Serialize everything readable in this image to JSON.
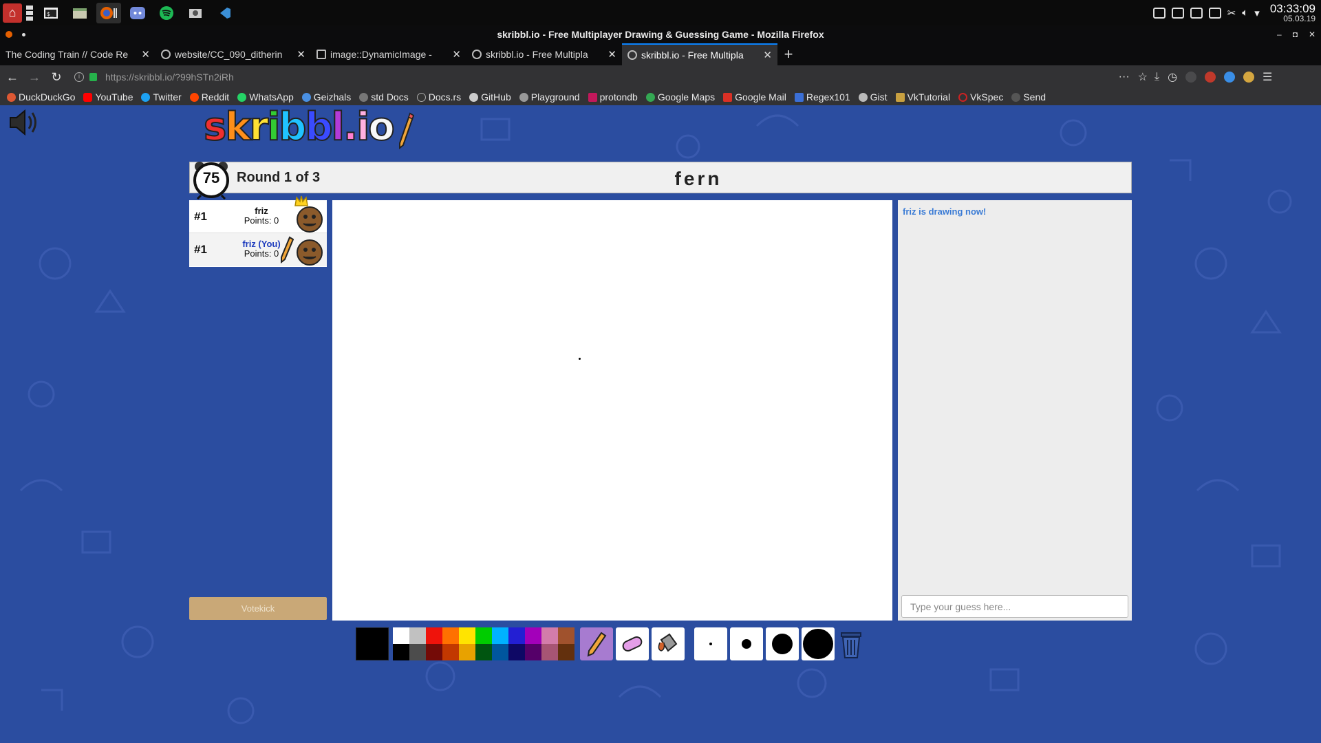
{
  "os": {
    "clock_time": "03:33:09",
    "clock_date": "05.03.19"
  },
  "window": {
    "title": "skribbl.io - Free Multiplayer Drawing & Guessing Game - Mozilla Firefox"
  },
  "tabs": [
    {
      "label": "The Coding Train // Code Re",
      "active": false
    },
    {
      "label": "website/CC_090_ditherin",
      "active": false
    },
    {
      "label": "image::DynamicImage -",
      "active": false
    },
    {
      "label": "skribbl.io - Free Multipla",
      "active": false
    },
    {
      "label": "skribbl.io - Free Multipla",
      "active": true
    }
  ],
  "nav": {
    "url": "https://skribbl.io/?99hSTn2iRh"
  },
  "bookmarks": [
    {
      "label": "DuckDuckGo",
      "color": "#de5833"
    },
    {
      "label": "YouTube",
      "color": "#ff0000"
    },
    {
      "label": "Twitter",
      "color": "#1da1f2"
    },
    {
      "label": "Reddit",
      "color": "#ff4500"
    },
    {
      "label": "WhatsApp",
      "color": "#25d366"
    },
    {
      "label": "Geizhals",
      "color": "#4a90e2"
    },
    {
      "label": "std Docs",
      "color": "#777777"
    },
    {
      "label": "Docs.rs",
      "color": "#333333"
    },
    {
      "label": "GitHub",
      "color": "#cccccc"
    },
    {
      "label": "Playground",
      "color": "#999999"
    },
    {
      "label": "protondb",
      "color": "#c2185b"
    },
    {
      "label": "Google Maps",
      "color": "#34a853"
    },
    {
      "label": "Google Mail",
      "color": "#d93025"
    },
    {
      "label": "Regex101",
      "color": "#3b6fd6"
    },
    {
      "label": "Gist",
      "color": "#bbbbbb"
    },
    {
      "label": "VkTutorial",
      "color": "#c8a040"
    },
    {
      "label": "VkSpec",
      "color": "#cc2222"
    },
    {
      "label": "Send",
      "color": "#555555"
    }
  ],
  "game": {
    "logo": "skribbl.io",
    "timer": "75",
    "round": "Round 1 of 3",
    "word": "fern",
    "players": [
      {
        "rank": "#1",
        "name": "friz",
        "points": "Points: 0",
        "crown": true,
        "drawing": false
      },
      {
        "rank": "#1",
        "name": "friz (You)",
        "points": "Points: 0",
        "crown": false,
        "drawing": true
      }
    ],
    "votekick": "Votekick",
    "chat_message": "friz is drawing now!",
    "guess_placeholder": "Type your guess here...",
    "palette_top": [
      "#ffffff",
      "#c1c1c1",
      "#ef130b",
      "#ff7100",
      "#ffe400",
      "#00cc00",
      "#00b2ff",
      "#231fd3",
      "#a300ba",
      "#d37caa",
      "#a0522d"
    ],
    "palette_bottom": [
      "#000000",
      "#4c4c4c",
      "#740b07",
      "#c23800",
      "#e8a200",
      "#005510",
      "#00569e",
      "#0e0865",
      "#550069",
      "#a75574",
      "#63300d"
    ],
    "current_color": "#000000",
    "selected_tool": "pencil"
  }
}
